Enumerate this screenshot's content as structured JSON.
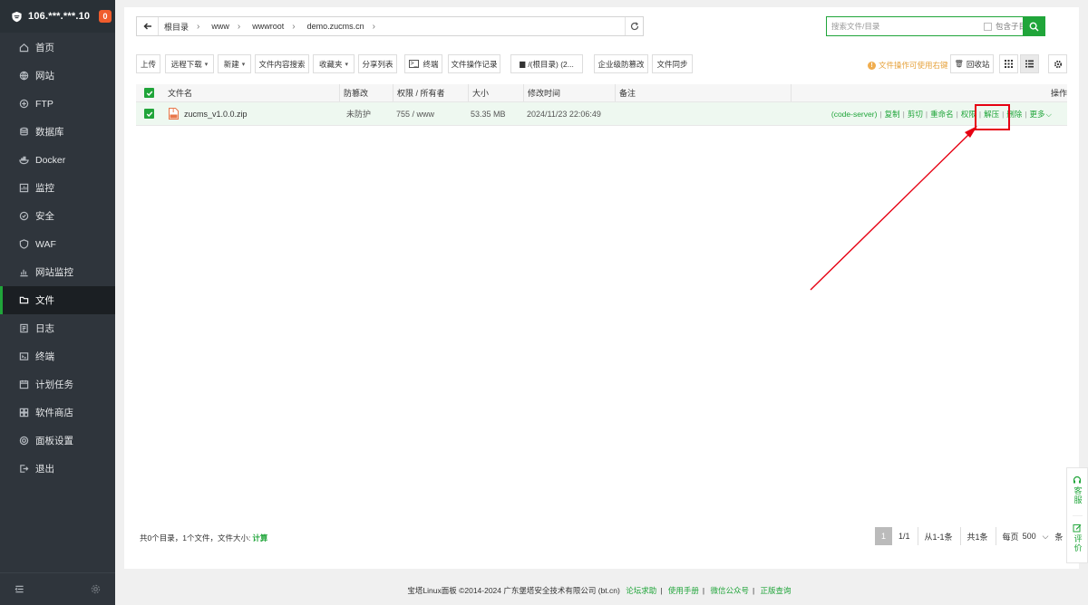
{
  "server": {
    "ip": "106.***.***.10",
    "alerts": "0"
  },
  "sidebar": {
    "items": [
      {
        "label": "首页",
        "icon": "home-icon"
      },
      {
        "label": "网站",
        "icon": "globe-icon"
      },
      {
        "label": "FTP",
        "icon": "ftp-icon"
      },
      {
        "label": "数据库",
        "icon": "database-icon"
      },
      {
        "label": "Docker",
        "icon": "docker-icon"
      },
      {
        "label": "监控",
        "icon": "monitor-icon"
      },
      {
        "label": "安全",
        "icon": "shield-check-icon"
      },
      {
        "label": "WAF",
        "icon": "waf-icon"
      },
      {
        "label": "网站监控",
        "icon": "chart-icon"
      },
      {
        "label": "文件",
        "icon": "folder-icon",
        "active": true
      },
      {
        "label": "日志",
        "icon": "log-icon"
      },
      {
        "label": "终端",
        "icon": "terminal-icon"
      },
      {
        "label": "计划任务",
        "icon": "task-icon"
      },
      {
        "label": "软件商店",
        "icon": "store-icon"
      },
      {
        "label": "面板设置",
        "icon": "settings-icon"
      },
      {
        "label": "退出",
        "icon": "logout-icon"
      }
    ]
  },
  "path": {
    "crumbs": [
      "根目录",
      "www",
      "wwwroot",
      "demo.zucms.cn"
    ]
  },
  "search": {
    "placeholder": "搜索文件/目录",
    "include_subdir": "包含子目录"
  },
  "toolbar": {
    "upload": "上传",
    "remote_download": "远程下载",
    "new": "新建",
    "content_search": "文件内容搜索",
    "favorites": "收藏夹",
    "share_list": "分享列表",
    "terminal": "终端",
    "op_log": "文件操作记录",
    "disk": "/(根目录) (2...",
    "tamper": "企业级防篡改",
    "sync": "文件同步",
    "tip": "文件操作可使用右键",
    "recycle": "回收站"
  },
  "table": {
    "headers": {
      "name": "文件名",
      "tamper": "防篡改",
      "perm": "权限 / 所有者",
      "size": "大小",
      "mtime": "修改时间",
      "note": "备注",
      "ops": "操作"
    },
    "rows": [
      {
        "name": "zucms_v1.0.0.zip",
        "tamper": "未防护",
        "perm": "755 / www",
        "size": "53.35 MB",
        "mtime": "2024/11/23 22:06:49",
        "note": ""
      }
    ],
    "ops": {
      "code_server": "(code-server)",
      "copy": "复制",
      "cut": "剪切",
      "rename": "重命名",
      "perm": "权限",
      "extract": "解压",
      "delete": "删除",
      "more": "更多"
    }
  },
  "summary": {
    "text": "共0个目录，1个文件，文件大小:",
    "calc": "计算"
  },
  "pager": {
    "current": "1",
    "pages": "1/1",
    "range": "从1-1条",
    "total": "共1条",
    "per_page_label": "每页",
    "per_page": "500",
    "unit": "条"
  },
  "copyright": {
    "text": "宝塔Linux面板 ©2014-2024 广东堡塔安全技术有限公司 (bt.cn)",
    "links": [
      "论坛求助",
      "使用手册",
      "微信公众号",
      "正版查询"
    ]
  },
  "float": {
    "service": "客服",
    "review": "评价"
  },
  "colors": {
    "accent": "#20a53a",
    "sidebar_bg": "#2f353c",
    "highlight": "#e60012",
    "badge": "#f05c2c"
  }
}
